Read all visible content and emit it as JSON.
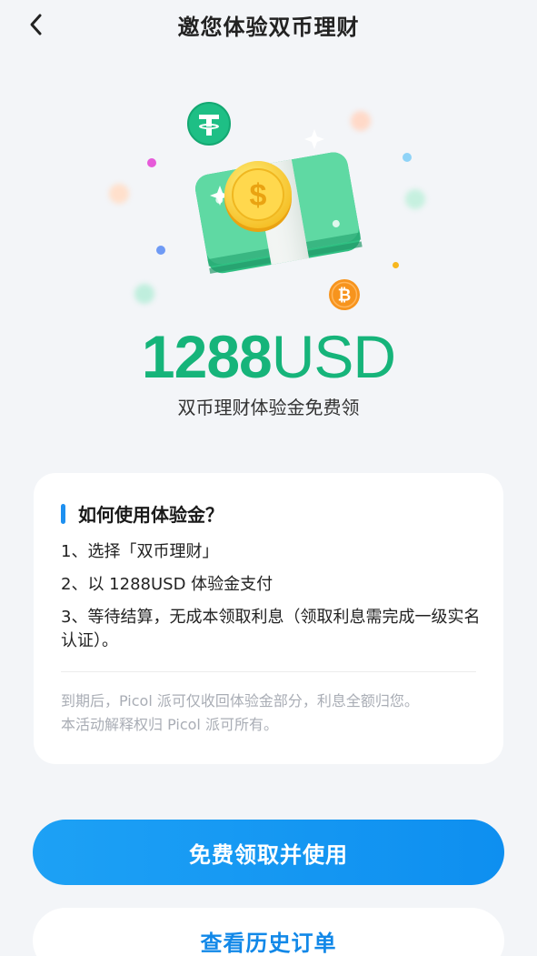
{
  "header": {
    "title": "邀您体验双币理财",
    "back_icon": "chevron-left-icon"
  },
  "hero": {
    "amount_number": "1288",
    "amount_unit": "USD",
    "subtitle": "双币理财体验金免费领",
    "icons": [
      "tether-coin-icon",
      "bitcoin-coin-icon",
      "dollar-coin-icon",
      "cash-stack-icon"
    ]
  },
  "card": {
    "heading": "如何使用体验金？",
    "steps": [
      "1、选择「双币理财」",
      "2、以 1288USD 体验金支付",
      "3、等待结算，无成本领取利息（领取利息需完成一级实名认证）。"
    ],
    "note_lines": [
      "到期后，Picol 派可仅收回体验金部分，利息全额归您。",
      "本活动解释权归 Picol 派可所有。"
    ]
  },
  "buttons": {
    "primary_label": "免费领取并使用",
    "secondary_label": "查看历史订单"
  },
  "colors": {
    "accent_green": "#16b47a",
    "accent_blue": "#1593f0",
    "background": "#f3f5f8"
  }
}
